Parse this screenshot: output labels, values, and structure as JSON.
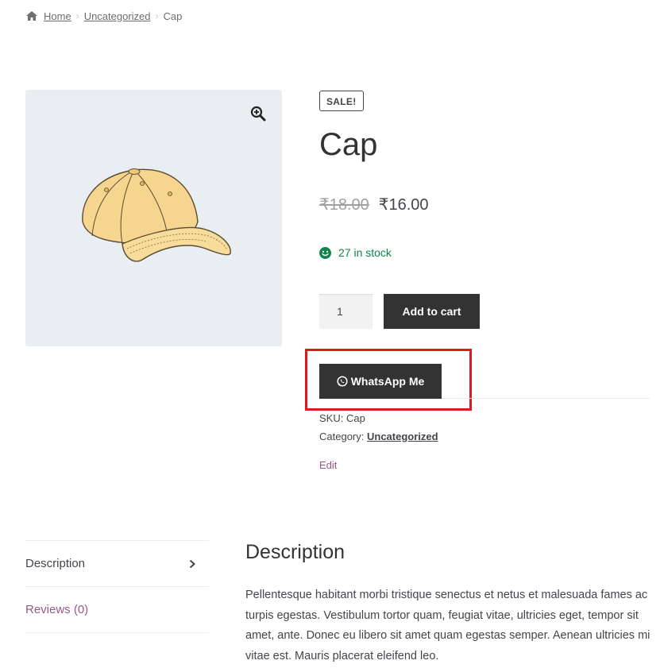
{
  "breadcrumb": {
    "home": "Home",
    "category": "Uncategorized",
    "current": "Cap",
    "separator": "›"
  },
  "product": {
    "sale_badge": "SALE!",
    "title": "Cap",
    "regular_price": "₹18.00",
    "sale_price": "₹16.00",
    "stock": "27 in stock",
    "quantity": "1",
    "add_to_cart_label": "Add to cart",
    "whatsapp_label": "WhatsApp Me",
    "sku_label": "SKU:",
    "sku_value": "Cap",
    "category_label": "Category:",
    "category_value": "Uncategorized",
    "edit_label": "Edit"
  },
  "tabs": [
    {
      "label": "Description"
    },
    {
      "label": "Reviews (0)"
    }
  ],
  "description": {
    "heading": "Description",
    "text": "Pellentesque habitant morbi tristique senectus et netus et malesuada fames ac turpis egestas. Vestibulum tortor quam, feugiat vitae, ultricies eget, tempor sit amet, ante. Donec eu libero sit amet quam egestas semper. Aenean ultricies mi vitae est. Mauris placerat eleifend leo."
  },
  "icons": {
    "home": "home-icon",
    "zoom": "zoom-in-icon",
    "stock": "smiley-icon",
    "whatsapp": "whatsapp-icon",
    "chevron": "chevron-right-icon"
  },
  "colors": {
    "button": "#333333",
    "stock": "#0f834d",
    "link_purple": "#96588a",
    "highlight": "#e3151d",
    "image_bg": "#e9eef3"
  }
}
